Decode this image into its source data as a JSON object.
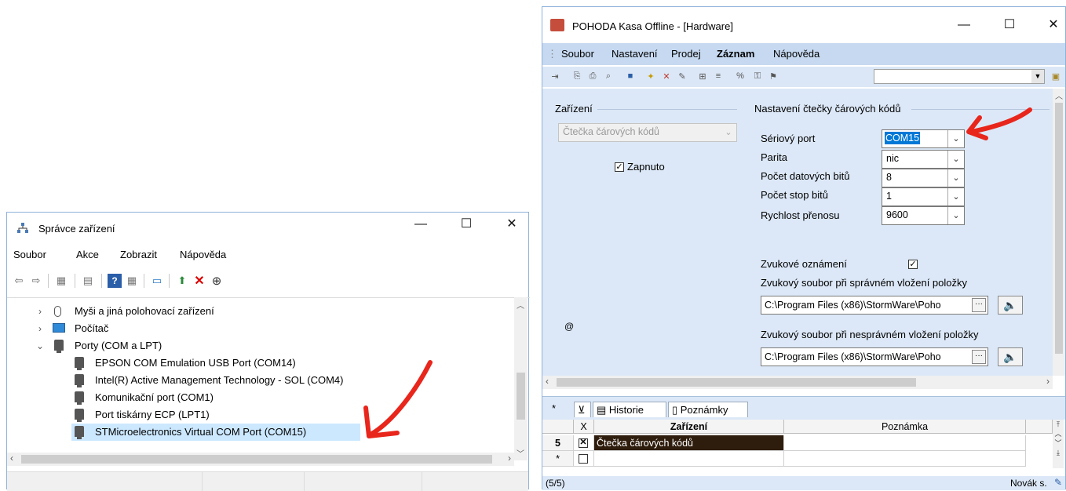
{
  "device_manager": {
    "title": "Správce zařízení",
    "window_buttons": {
      "minimize": "—",
      "maximize": "☐",
      "close": "✕"
    },
    "menu": [
      "Soubor",
      "Akce",
      "Zobrazit",
      "Nápověda"
    ],
    "tree": [
      {
        "label": "Myši a jiná polohovací zařízení",
        "expanded": false,
        "icon": "mouse-icon"
      },
      {
        "label": "Počítač",
        "expanded": false,
        "icon": "computer-icon"
      },
      {
        "label": "Porty (COM a LPT)",
        "expanded": true,
        "icon": "port-icon"
      },
      {
        "label": "EPSON COM Emulation USB Port (COM14)",
        "icon": "port-icon"
      },
      {
        "label": "Intel(R) Active Management Technology - SOL (COM4)",
        "icon": "port-icon"
      },
      {
        "label": "Komunikační port (COM1)",
        "icon": "port-icon"
      },
      {
        "label": "Port tiskárny ECP (LPT1)",
        "icon": "port-icon"
      },
      {
        "label": "STMicroelectronics Virtual COM Port (COM15)",
        "icon": "port-icon",
        "selected": true
      }
    ]
  },
  "pohoda": {
    "title": "POHODA Kasa Offline - [Hardware]",
    "window_buttons": {
      "minimize": "—",
      "maximize": "☐",
      "close": "✕"
    },
    "menu": [
      "Soubor",
      "Nastavení",
      "Prodej",
      "Záznam",
      "Nápověda"
    ],
    "device_section": {
      "heading": "Zařízení",
      "device_select": "Čtečka čárových kódů",
      "enabled_label": "Zapnuto",
      "enabled": true,
      "at_sign": "@"
    },
    "scanner_settings": {
      "heading": "Nastavení čtečky čárových kódů",
      "fields": [
        {
          "label": "Sériový port",
          "value": "COM15"
        },
        {
          "label": "Parita",
          "value": "nic"
        },
        {
          "label": "Počet datových bitů",
          "value": "8"
        },
        {
          "label": "Počet stop bitů",
          "value": "1"
        },
        {
          "label": "Rychlost přenosu",
          "value": "9600"
        }
      ],
      "sound_label": "Zvukové oznámení",
      "sound_enabled": true,
      "sound_ok_label": "Zvukový soubor při správném vložení položky",
      "sound_ok_path": "C:\\Program Files (x86)\\StormWare\\Poho",
      "sound_err_label": "Zvukový soubor při nesprávném vložení položky",
      "sound_err_path": "C:\\Program Files (x86)\\StormWare\\Poho"
    },
    "tabs": [
      "*",
      "Historie",
      "Poznámky"
    ],
    "grid": {
      "columns": [
        "X",
        "Zařízení",
        "Poznámka"
      ],
      "rows": [
        {
          "num": "5",
          "checked": true,
          "device": "Čtečka čárových kódů",
          "note": ""
        },
        {
          "num": "*",
          "checked": false,
          "device": "",
          "note": ""
        }
      ]
    },
    "status": {
      "count": "(5/5)",
      "user": "Novák s."
    }
  }
}
